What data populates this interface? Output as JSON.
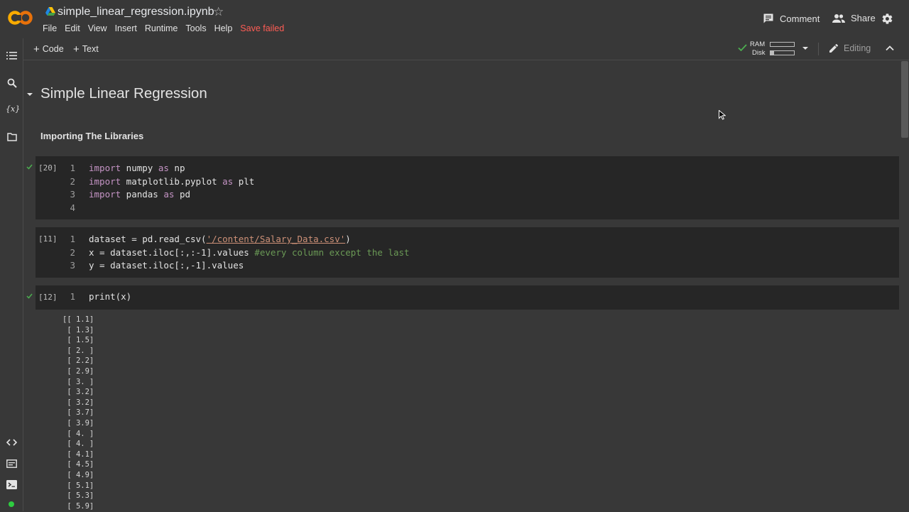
{
  "header": {
    "title": "simple_linear_regression.ipynb",
    "menu": [
      "File",
      "Edit",
      "View",
      "Insert",
      "Runtime",
      "Tools",
      "Help"
    ],
    "save_status": "Save failed",
    "comment_label": "Comment",
    "share_label": "Share"
  },
  "toolbar": {
    "code_label": "Code",
    "text_label": "Text",
    "ram_label": "RAM",
    "disk_label": "Disk",
    "ram_fraction": 0.0,
    "disk_fraction": 0.15,
    "editing_label": "Editing"
  },
  "notebook": {
    "heading": "Simple Linear Regression",
    "subheading": "Importing The Libraries",
    "cells": [
      {
        "exec": "[20]",
        "status": "success",
        "lines": [
          [
            [
              "kw",
              "import"
            ],
            [
              "id",
              " numpy "
            ],
            [
              "kw",
              "as"
            ],
            [
              "id",
              " np"
            ]
          ],
          [
            [
              "kw",
              "import"
            ],
            [
              "id",
              " matplotlib.pyplot "
            ],
            [
              "kw",
              "as"
            ],
            [
              "id",
              " plt"
            ]
          ],
          [
            [
              "kw",
              "import"
            ],
            [
              "id",
              " pandas "
            ],
            [
              "kw",
              "as"
            ],
            [
              "id",
              " pd"
            ]
          ],
          []
        ]
      },
      {
        "exec": "[11]",
        "status": "",
        "lines": [
          [
            [
              "id",
              "dataset = pd.read_csv("
            ],
            [
              "str",
              "'/content/Salary_Data.csv'"
            ],
            [
              "id",
              ")"
            ]
          ],
          [
            [
              "id",
              "x = dataset.iloc[:,:-1].values "
            ],
            [
              "cm",
              "#every column except the last"
            ]
          ],
          [
            [
              "id",
              "y = dataset.iloc[:,-1].values"
            ]
          ]
        ]
      },
      {
        "exec": "[12]",
        "status": "success",
        "lines": [
          [
            [
              "id",
              "print(x)"
            ]
          ]
        ]
      }
    ],
    "output": [
      "[[ 1.1]",
      " [ 1.3]",
      " [ 1.5]",
      " [ 2. ]",
      " [ 2.2]",
      " [ 2.9]",
      " [ 3. ]",
      " [ 3.2]",
      " [ 3.2]",
      " [ 3.7]",
      " [ 3.9]",
      " [ 4. ]",
      " [ 4. ]",
      " [ 4.1]",
      " [ 4.5]",
      " [ 4.9]",
      " [ 5.1]",
      " [ 5.3]",
      " [ 5.9]"
    ]
  }
}
